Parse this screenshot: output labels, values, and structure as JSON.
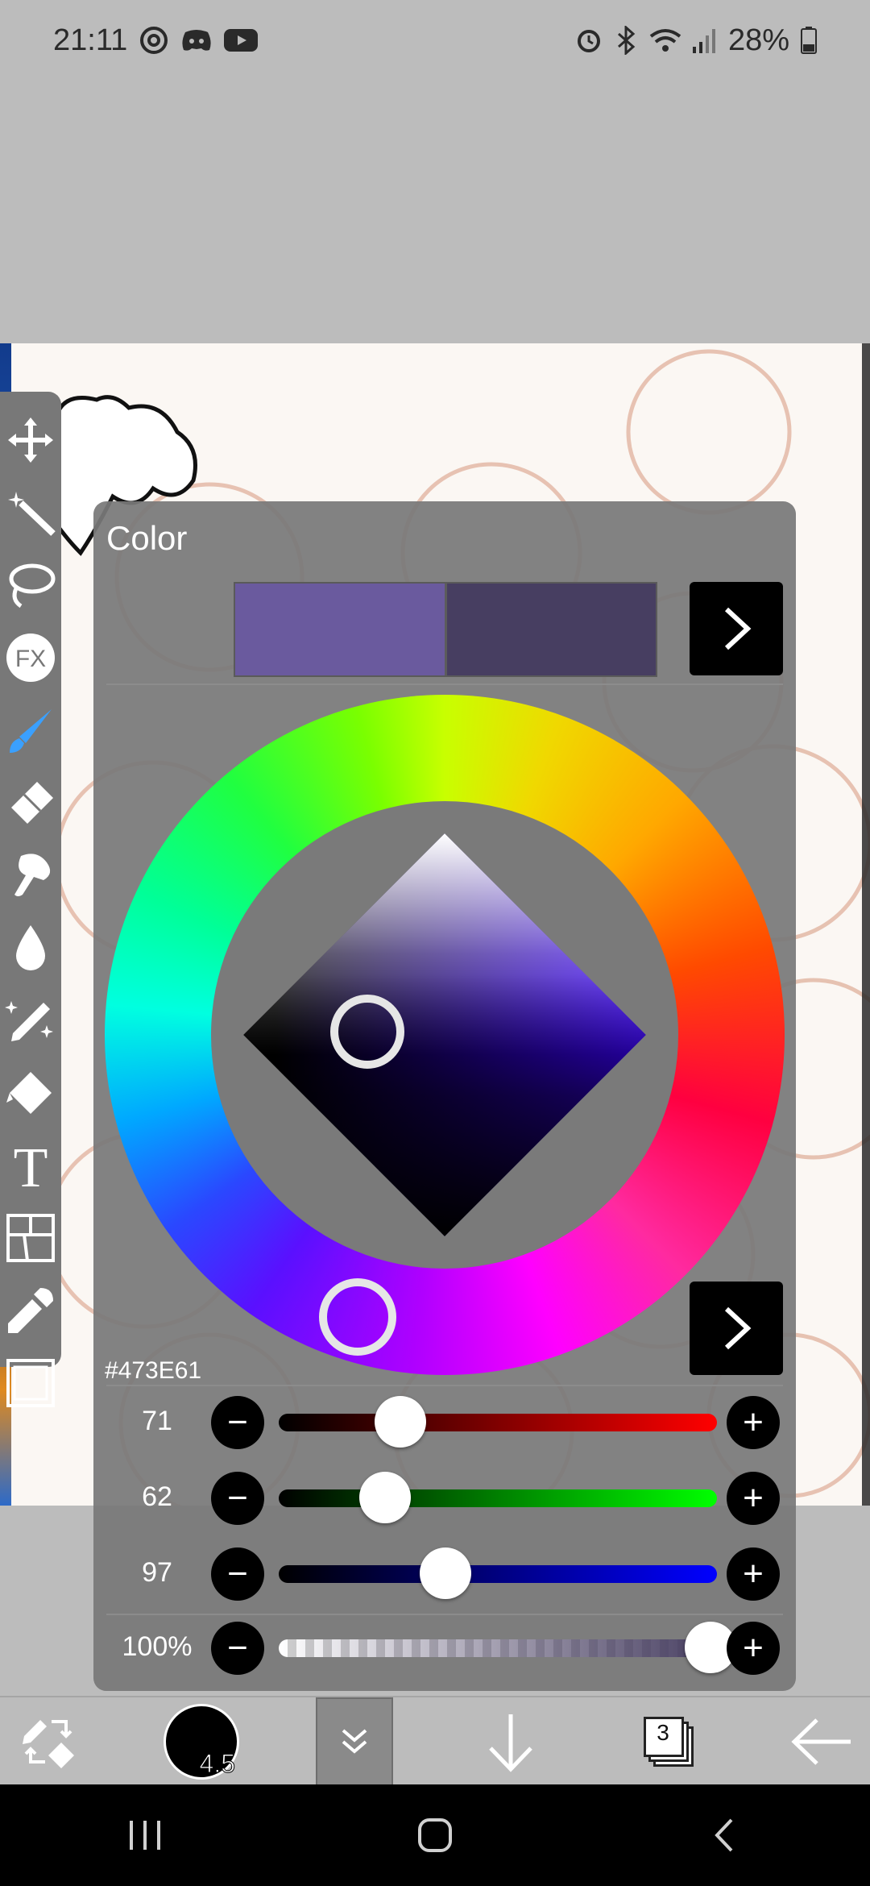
{
  "status_bar": {
    "time": "21:11",
    "battery": "28%",
    "left_icons": [
      "threads-icon",
      "discord-icon",
      "youtube-icon"
    ],
    "right_icons": [
      "alarm-icon",
      "bluetooth-icon",
      "wifi-icon",
      "signal-icon",
      "battery-icon"
    ]
  },
  "color_panel": {
    "title": "Color",
    "current_color": "#6A5A9E",
    "previous_color": "#473E61",
    "hex_value": "#473E61",
    "sliders": [
      {
        "label": "71",
        "channel": "red",
        "value": 71,
        "max": 255,
        "color": "#ff0000"
      },
      {
        "label": "62",
        "channel": "green",
        "value": 62,
        "max": 255,
        "color": "#00ff00"
      },
      {
        "label": "97",
        "channel": "blue",
        "value": 97,
        "max": 255,
        "color": "#0000ff"
      }
    ],
    "opacity": {
      "label": "100%",
      "value": 100
    },
    "minus_label": "−",
    "plus_label": "+"
  },
  "bottom_bar": {
    "brush_size": "4.5",
    "layer_count": "3"
  },
  "toolbar": {
    "tools": [
      "move-tool-icon",
      "magic-wand-icon",
      "lasso-icon",
      "fx-icon",
      "brush-icon",
      "eraser-icon",
      "smudge-icon",
      "blur-icon",
      "magic-brush-icon",
      "fill-icon",
      "text-icon",
      "frame-divider-icon",
      "eyedropper-icon",
      "canvas-icon"
    ],
    "fx_label": "FX",
    "text_label": "T"
  },
  "colors": {
    "panel_bg": "#787878",
    "toolbar_bg": "#787878",
    "accent_brush": "#3aa0ff"
  }
}
